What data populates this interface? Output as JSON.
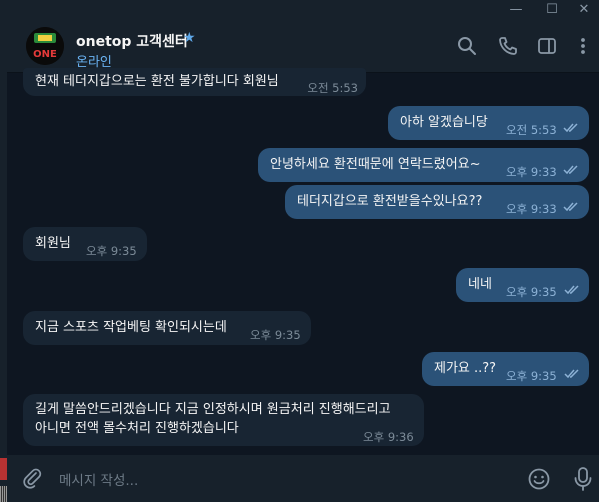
{
  "window": {
    "minimize_glyph": "—",
    "maximize_glyph": "☐",
    "close_glyph": "✕"
  },
  "header": {
    "title": "onetop 고객센터",
    "verified_icon": "star-icon",
    "status": "온라인",
    "avatar_text": "ONE",
    "icons": [
      "search-icon",
      "phone-icon",
      "sidebar-toggle-icon",
      "more-vert-icon"
    ]
  },
  "messages": [
    {
      "direction": "in",
      "text": "현재 테더지갑으로는 환전 불가합니다 회원님",
      "time": "오전 5:53"
    },
    {
      "direction": "out",
      "text": "아하 알겠습니당",
      "time": "오전 5:53",
      "read": true
    },
    {
      "direction": "out",
      "text": "안녕하세요 환전때문에 연락드렸어요~",
      "time": "오후 9:33",
      "read": true
    },
    {
      "direction": "out",
      "text": "테더지갑으로 환전받을수있나요??",
      "time": "오후 9:33",
      "read": true
    },
    {
      "direction": "in",
      "text": "회원님",
      "time": "오후 9:35"
    },
    {
      "direction": "out",
      "text": "네네",
      "time": "오후 9:35",
      "read": true
    },
    {
      "direction": "in",
      "text": "지금 스포츠 작업베팅 확인되시는데",
      "time": "오후 9:35"
    },
    {
      "direction": "out",
      "text": "제가요 ..??",
      "time": "오후 9:35",
      "read": true
    },
    {
      "direction": "in",
      "line1": "길게 말씀안드리겠습니다 지금 인정하시며 원금처리 진행해드리고",
      "line2": "아니면 전액 몰수처리 진행하겠습니다",
      "time": "오후 9:36"
    }
  ],
  "composer": {
    "placeholder": "메시지 작성...",
    "icons": [
      "paperclip-icon",
      "emoji-icon",
      "microphone-icon"
    ]
  },
  "colors": {
    "background": "#0e1621",
    "panel": "#17212b",
    "incoming_bubble": "#182533",
    "outgoing_bubble": "#2b5278",
    "accent": "#6ab3f3"
  }
}
